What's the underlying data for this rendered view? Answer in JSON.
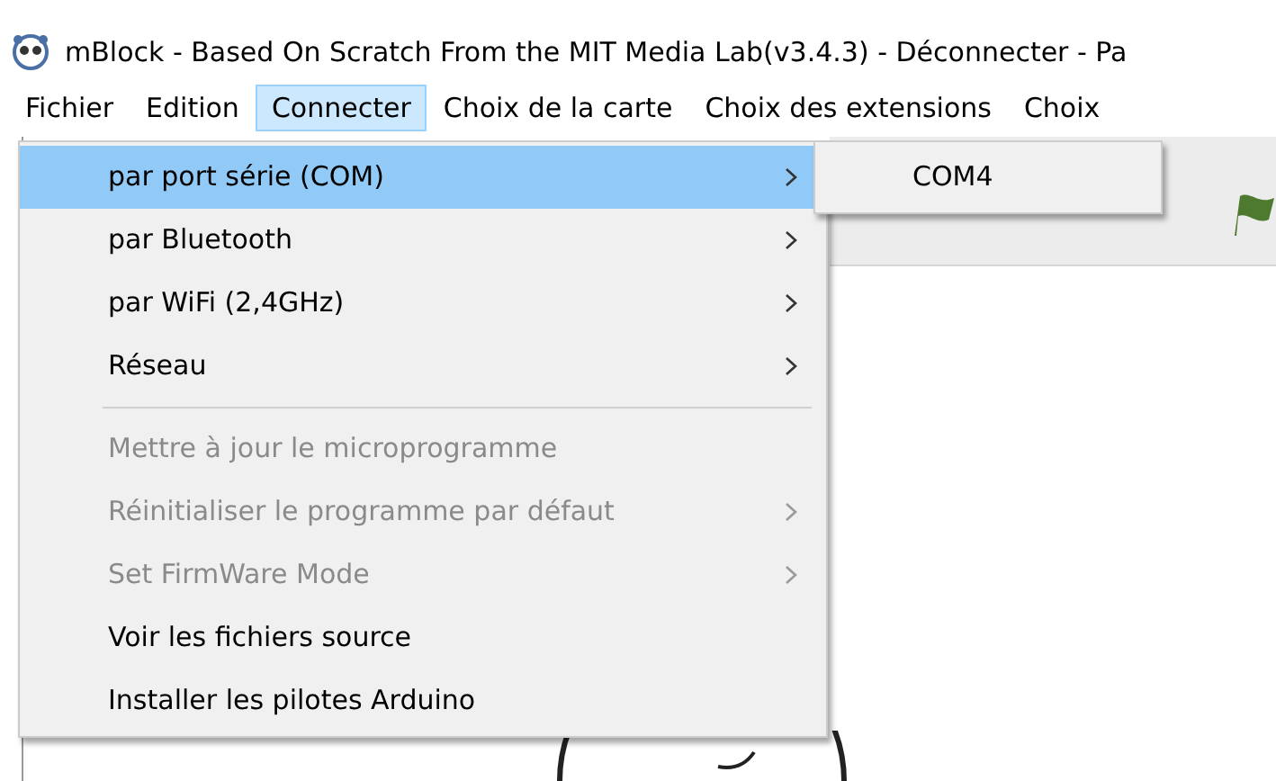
{
  "window": {
    "title": "mBlock - Based On Scratch From the MIT Media Lab(v3.4.3) - Déconnecter - Pa"
  },
  "menubar": [
    {
      "label": "Fichier",
      "selected": false
    },
    {
      "label": "Edition",
      "selected": false
    },
    {
      "label": "Connecter",
      "selected": true
    },
    {
      "label": "Choix de la carte",
      "selected": false
    },
    {
      "label": "Choix des extensions",
      "selected": false
    },
    {
      "label": "Choix",
      "selected": false
    }
  ],
  "menu": [
    {
      "kind": "item",
      "label": "par port série (COM)",
      "submenu": true,
      "disabled": false,
      "selected": true
    },
    {
      "kind": "item",
      "label": "par Bluetooth",
      "submenu": true,
      "disabled": false,
      "selected": false
    },
    {
      "kind": "item",
      "label": "par WiFi (2,4GHz)",
      "submenu": true,
      "disabled": false,
      "selected": false
    },
    {
      "kind": "item",
      "label": "Réseau",
      "submenu": true,
      "disabled": false,
      "selected": false
    },
    {
      "kind": "separator"
    },
    {
      "kind": "item",
      "label": "Mettre à jour le microprogramme",
      "submenu": false,
      "disabled": true,
      "selected": false
    },
    {
      "kind": "item",
      "label": "Réinitialiser le programme par défaut",
      "submenu": true,
      "disabled": true,
      "selected": false
    },
    {
      "kind": "item",
      "label": "Set FirmWare Mode",
      "submenu": true,
      "disabled": true,
      "selected": false
    },
    {
      "kind": "item",
      "label": "Voir les fichiers source",
      "submenu": false,
      "disabled": false,
      "selected": false
    },
    {
      "kind": "item",
      "label": "Installer les pilotes Arduino",
      "submenu": false,
      "disabled": false,
      "selected": false
    }
  ],
  "submenu": [
    {
      "label": "COM4",
      "selected": false
    }
  ]
}
